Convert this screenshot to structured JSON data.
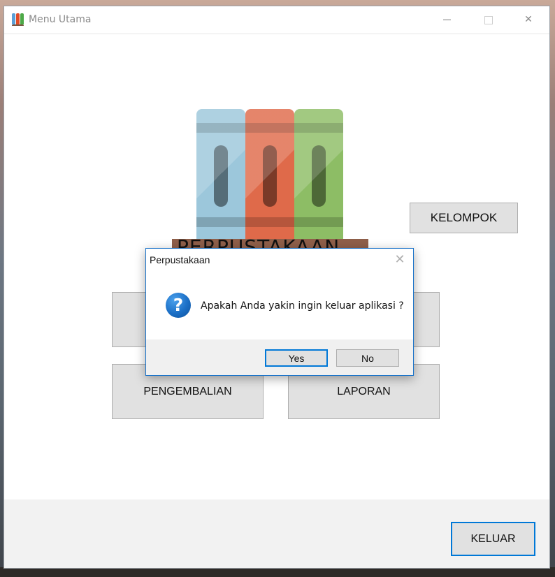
{
  "window": {
    "title": "Menu Utama",
    "minimize_glyph": "",
    "maximize_glyph": "",
    "close_glyph": "✕"
  },
  "logo": {
    "icon": "bookshelf-logo",
    "text": "PERPUSTAKAAN"
  },
  "menu": {
    "kelompok_label": "KELOMPOK",
    "pengembalian_label": "PENGEMBALIAN",
    "laporan_label": "LAPORAN",
    "keluar_label": "KELUAR"
  },
  "dialog": {
    "title": "Perpustakaan",
    "close_glyph": "✕",
    "icon": "question-icon",
    "icon_glyph": "?",
    "message": "Apakah Anda yakin ingin keluar aplikasi ?",
    "yes_label": "Yes",
    "no_label": "No"
  },
  "colors": {
    "accent": "#0078d7",
    "button_face": "#e1e1e1",
    "book_blue": "#9cc7db",
    "book_red": "#df6a4a",
    "book_green": "#8dbd65",
    "shelf": "#8f5f4a"
  }
}
